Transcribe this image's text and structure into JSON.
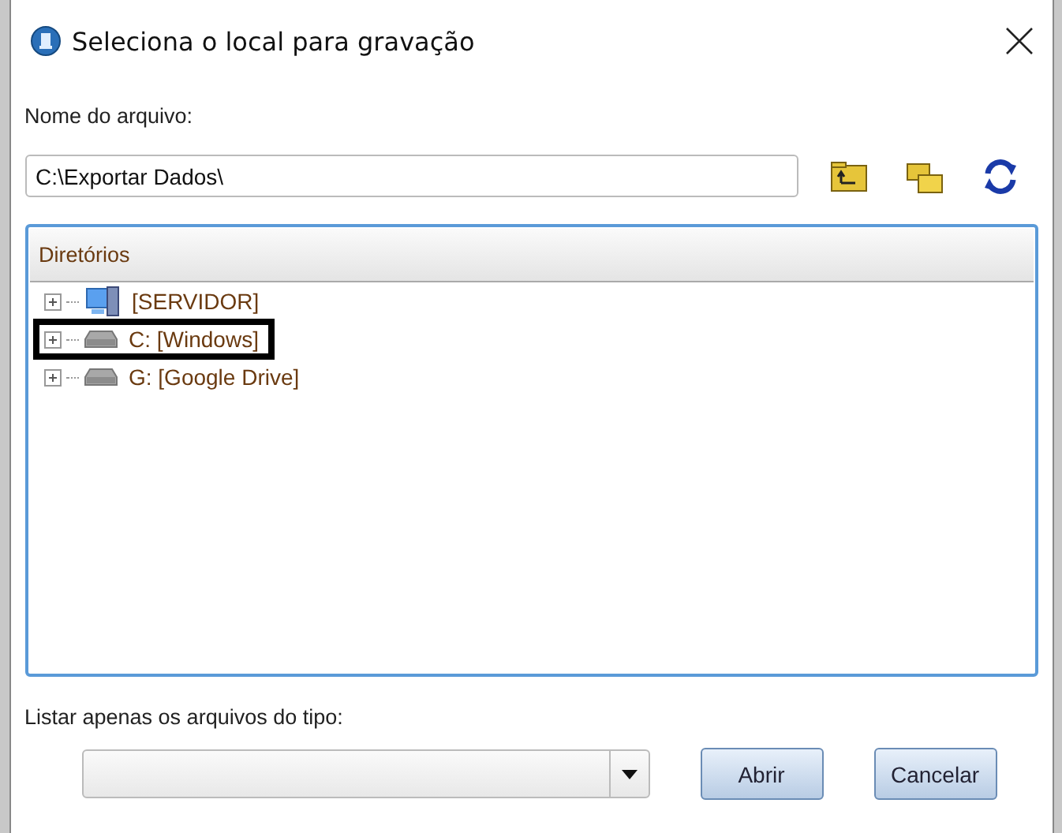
{
  "window": {
    "title": "Seleciona o local para gravação"
  },
  "file_name": {
    "label": "Nome do arquivo:",
    "value": "C:\\Exportar Dados\\"
  },
  "tree": {
    "header": "Diretórios",
    "items": [
      {
        "label": "[SERVIDOR]",
        "kind": "server",
        "expanded": false,
        "highlighted": false
      },
      {
        "label": "C: [Windows]",
        "kind": "drive",
        "expanded": false,
        "highlighted": true
      },
      {
        "label": "G: [Google Drive]",
        "kind": "drive",
        "expanded": false,
        "highlighted": false
      }
    ]
  },
  "filter": {
    "label": "Listar apenas os arquivos do tipo:"
  },
  "buttons": [
    "Abrir",
    "Cancelar"
  ]
}
